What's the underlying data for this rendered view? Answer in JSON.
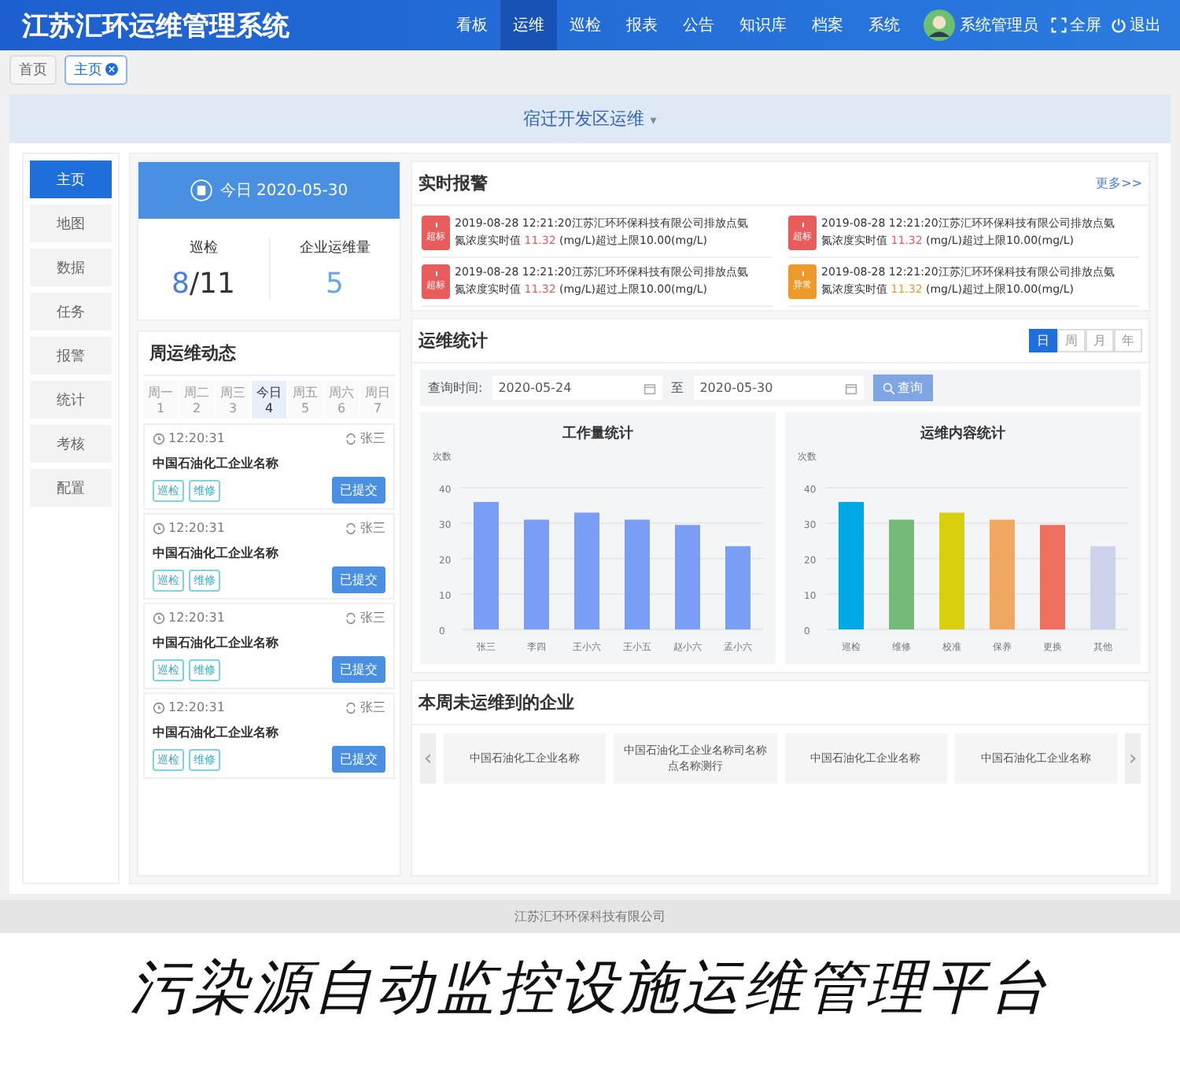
{
  "header": {
    "title": "江苏汇环运维管理系统",
    "nav": [
      {
        "label": "看板",
        "selected": false
      },
      {
        "label": "运维",
        "selected": true
      },
      {
        "label": "巡检",
        "selected": false
      },
      {
        "label": "报表",
        "selected": false
      },
      {
        "label": "公告",
        "selected": false
      },
      {
        "label": "知识库",
        "selected": false
      },
      {
        "label": "档案",
        "selected": false
      },
      {
        "label": "系统",
        "selected": false
      }
    ],
    "user": "系统管理员",
    "fullscreen": "全屏",
    "logout": "退出"
  },
  "tabs": [
    {
      "label": "首页",
      "selected": false,
      "closable": false
    },
    {
      "label": "主页",
      "selected": true,
      "closable": true
    }
  ],
  "region": {
    "label": "宿迁开发区运维",
    "caret": "▾"
  },
  "sidebar": [
    {
      "label": "主页",
      "selected": true
    },
    {
      "label": "地图",
      "selected": false
    },
    {
      "label": "数据",
      "selected": false
    },
    {
      "label": "任务",
      "selected": false
    },
    {
      "label": "报警",
      "selected": false
    },
    {
      "label": "统计",
      "selected": false
    },
    {
      "label": "考核",
      "selected": false
    },
    {
      "label": "配置",
      "selected": false
    }
  ],
  "today": {
    "label": "今日 2020-05-30",
    "stats": [
      {
        "label": "巡检",
        "done": "8",
        "total": "/11"
      },
      {
        "label": "企业运维量",
        "done": "5"
      }
    ]
  },
  "week": {
    "title": "周运维动态",
    "days": [
      {
        "name": "周一",
        "num": "1",
        "selected": false
      },
      {
        "name": "周二",
        "num": "2",
        "selected": false
      },
      {
        "name": "周三",
        "num": "3",
        "selected": false
      },
      {
        "name": "今日",
        "num": "4",
        "selected": true
      },
      {
        "name": "周五",
        "num": "5",
        "selected": false
      },
      {
        "name": "周六",
        "num": "6",
        "selected": false
      },
      {
        "name": "周日",
        "num": "7",
        "selected": false
      }
    ],
    "tasks": [
      {
        "time": "12:20:31",
        "person": "张三",
        "company": "中国石油化工企业名称",
        "tags": [
          "巡检",
          "维修"
        ],
        "status": "已提交"
      },
      {
        "time": "12:20:31",
        "person": "张三",
        "company": "中国石油化工企业名称",
        "tags": [
          "巡检",
          "维修"
        ],
        "status": "已提交"
      },
      {
        "time": "12:20:31",
        "person": "张三",
        "company": "中国石油化工企业名称",
        "tags": [
          "巡检",
          "维修"
        ],
        "status": "已提交"
      },
      {
        "time": "12:20:31",
        "person": "张三",
        "company": "中国石油化工企业名称",
        "tags": [
          "巡检",
          "维修"
        ],
        "status": "已提交"
      }
    ]
  },
  "alarms": {
    "title": "实时报警",
    "more": "更多>>",
    "items": [
      {
        "kind": "overlimit",
        "badge": "超标",
        "text1": "2019-08-28 12:21:20江苏汇环环保科技有限公司排放点氨",
        "text2": "氮浓度实时值 ",
        "value": "11.32",
        "text3": " (mg/L)超过上限10.00(mg/L)"
      },
      {
        "kind": "overlimit",
        "badge": "超标",
        "text1": "2019-08-28 12:21:20江苏汇环环保科技有限公司排放点氨",
        "text2": "氮浓度实时值 ",
        "value": "11.32",
        "text3": " (mg/L)超过上限10.00(mg/L)"
      },
      {
        "kind": "overlimit",
        "badge": "超标",
        "text1": "2019-08-28 12:21:20江苏汇环环保科技有限公司排放点氨",
        "text2": "氮浓度实时值 ",
        "value": "11.32",
        "text3": " (mg/L)超过上限10.00(mg/L)"
      },
      {
        "kind": "abnormal",
        "badge": "异常",
        "text1": "2019-08-28 12:21:20江苏汇环环保科技有限公司排放点氨",
        "text2": "氮浓度实时值 ",
        "value": "11.32",
        "text3": " (mg/L)超过上限10.00(mg/L)"
      }
    ]
  },
  "stats": {
    "title": "运维统计",
    "periods": [
      {
        "label": "日",
        "selected": true
      },
      {
        "label": "周",
        "selected": false
      },
      {
        "label": "月",
        "selected": false
      },
      {
        "label": "年",
        "selected": false
      }
    ],
    "query_label": "查询时间:",
    "from": "2020-05-24",
    "to_label": "至",
    "to": "2020-05-30",
    "query_button": "查询",
    "charts": [
      {
        "chart_data": {
          "type": "bar",
          "title": "工作量统计",
          "ylabel": "次数",
          "categories": [
            "张三",
            "李四",
            "王小六",
            "王小五",
            "赵小六",
            "孟小六"
          ],
          "series": [
            {
              "color": "#7a9ef5",
              "values": [
                36,
                31,
                33,
                31,
                29.5,
                23.5
              ]
            }
          ],
          "ylim": [
            0,
            40
          ],
          "yticks": [
            0,
            10,
            20,
            30,
            40
          ],
          "grid": true
        }
      },
      {
        "chart_data": {
          "type": "bar",
          "title": "运维内容统计",
          "ylabel": "次数",
          "categories": [
            "巡检",
            "维修",
            "校准",
            "保养",
            "更换",
            "其他"
          ],
          "stacked": true,
          "series": [
            {
              "color": "#00a8e6",
              "values": [
                36,
                null,
                null,
                null,
                null,
                null
              ]
            },
            {
              "color": "#74bb7a",
              "values": [
                null,
                31,
                null,
                null,
                null,
                null
              ]
            },
            {
              "color": "#d9cf0f",
              "values": [
                null,
                null,
                33,
                null,
                null,
                null
              ]
            },
            {
              "color": "#f0a860",
              "values": [
                null,
                null,
                null,
                31,
                null,
                null
              ]
            },
            {
              "color": "#f0705f",
              "values": [
                null,
                null,
                null,
                null,
                29.5,
                null
              ]
            },
            {
              "color": "#cdd3ea",
              "values": [
                null,
                null,
                null,
                null,
                null,
                23.5
              ]
            }
          ],
          "ylim": [
            0,
            40
          ],
          "yticks": [
            0,
            10,
            20,
            30,
            40
          ],
          "grid": true
        }
      }
    ]
  },
  "missed": {
    "title": "本周未运维到的企业",
    "prev": "‹",
    "next": "›",
    "companies": [
      "中国石油化工企业名称",
      "中国石油化工企业名称司名称点名称测行",
      "中国石油化工企业名称",
      "中国石油化工企业名称"
    ]
  },
  "footer": "江苏汇环环保科技有限公司",
  "caption": "污染源自动监控设施运维管理平台"
}
